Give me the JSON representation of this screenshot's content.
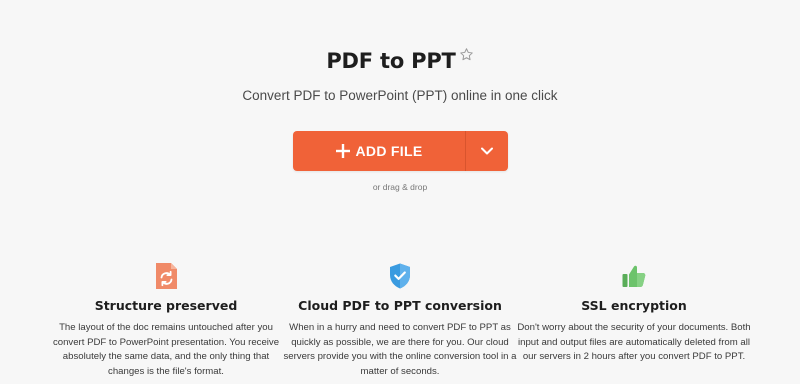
{
  "header": {
    "title": "PDF to PPT",
    "subtitle": "Convert PDF to PowerPoint (PPT) online in one click"
  },
  "upload": {
    "add_file_label": "ADD FILE",
    "drag_hint": "or drag & drop"
  },
  "features": [
    {
      "icon": "sync-document-icon",
      "title": "Structure preserved",
      "text": "The layout of the doc remains untouched after you convert PDF to PowerPoint presentation. You receive absolutely the same data, and the only thing that changes is the file's format."
    },
    {
      "icon": "shield-check-icon",
      "title": "Cloud PDF to PPT conversion",
      "text": "When in a hurry and need to convert PDF to PPT as quickly as possible, we are there for you. Our cloud servers provide you with the online conversion tool in a matter of seconds."
    },
    {
      "icon": "thumbs-up-icon",
      "title": "SSL encryption",
      "text": "Don't worry about the security of your documents. Both input and output files are automatically deleted from all our servers in 2 hours after you convert PDF to PPT."
    }
  ],
  "colors": {
    "accent": "#f06238",
    "shield": "#3a9be0",
    "thumb": "#6cc36b",
    "background": "#f7f7f7"
  }
}
